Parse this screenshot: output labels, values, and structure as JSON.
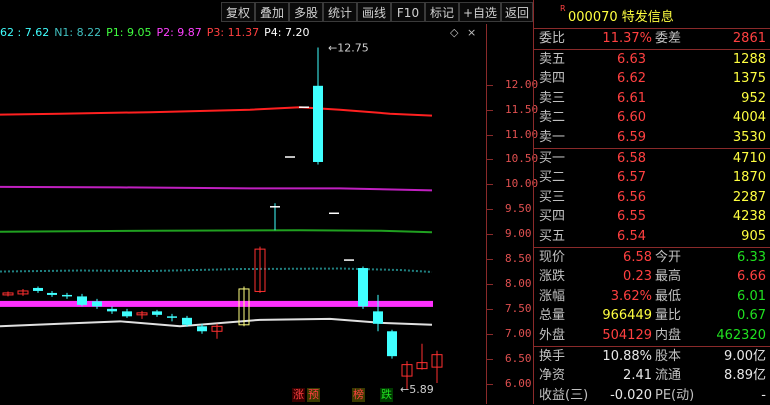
{
  "toolbar": {
    "buttons": [
      "复权",
      "叠加",
      "多股",
      "统计",
      "画线",
      "F10",
      "标记",
      "+自选",
      "返回"
    ]
  },
  "legend": [
    {
      "text": "62 : 7.62",
      "color": "#40ffff"
    },
    {
      "text": "N1: 8.22",
      "color": "#40c0c0"
    },
    {
      "text": "P1: 9.05",
      "color": "#40ff40"
    },
    {
      "text": "P2: 9.87",
      "color": "#ff40ff"
    },
    {
      "text": "P3: 11.37",
      "color": "#ff4040"
    },
    {
      "text": "P4: 7.20",
      "color": "#ffffff"
    }
  ],
  "price_axis": [
    "12.00",
    "11.50",
    "11.00",
    "10.50",
    "10.00",
    "9.50",
    "9.00",
    "8.50",
    "8.00",
    "7.50",
    "7.00",
    "6.50",
    "6.00"
  ],
  "chart_data": {
    "type": "candlestick",
    "ylim": [
      5.75,
      12.9
    ],
    "annotations": {
      "high_label": "12.75",
      "low_label": "5.89"
    },
    "bottom_tags": [
      "涨",
      "预",
      "榜",
      "跌"
    ]
  },
  "quote": {
    "stock_mark": "R",
    "stock_code_name": "000070 特发信息",
    "weibi_label": "委比",
    "weibi_value": "11.37%",
    "weicha_label": "委差",
    "weicha_value": "2861",
    "asks": [
      {
        "label": "卖五",
        "price": "6.63",
        "volume": "1288"
      },
      {
        "label": "卖四",
        "price": "6.62",
        "volume": "1375"
      },
      {
        "label": "卖三",
        "price": "6.61",
        "volume": "952"
      },
      {
        "label": "卖二",
        "price": "6.60",
        "volume": "4004"
      },
      {
        "label": "卖一",
        "price": "6.59",
        "volume": "3530"
      }
    ],
    "bids": [
      {
        "label": "买一",
        "price": "6.58",
        "volume": "4710"
      },
      {
        "label": "买二",
        "price": "6.57",
        "volume": "1870"
      },
      {
        "label": "买三",
        "price": "6.56",
        "volume": "2287"
      },
      {
        "label": "买四",
        "price": "6.55",
        "volume": "4238"
      },
      {
        "label": "买五",
        "price": "6.54",
        "volume": "905"
      }
    ],
    "stats": [
      {
        "l1": "现价",
        "v1": "6.58",
        "c1": "red",
        "l2": "今开",
        "v2": "6.33",
        "c2": "green"
      },
      {
        "l1": "涨跌",
        "v1": "0.23",
        "c1": "red",
        "l2": "最高",
        "v2": "6.66",
        "c2": "red"
      },
      {
        "l1": "涨幅",
        "v1": "3.62%",
        "c1": "red",
        "l2": "最低",
        "v2": "6.01",
        "c2": "green"
      },
      {
        "l1": "总量",
        "v1": "966449",
        "c1": "yellow",
        "l2": "量比",
        "v2": "0.67",
        "c2": "green"
      },
      {
        "l1": "外盘",
        "v1": "504129",
        "c1": "red",
        "l2": "内盘",
        "v2": "462320",
        "c2": "green"
      }
    ],
    "stats2": [
      {
        "l1": "换手",
        "v1": "10.88%",
        "l2": "股本",
        "v2": "9.00亿"
      },
      {
        "l1": "净资",
        "v1": "2.41",
        "l2": "流通",
        "v2": "8.89亿"
      },
      {
        "l1": "收益(三)",
        "v1": "-0.020",
        "l2": "PE(动)",
        "v2": "-"
      }
    ]
  }
}
